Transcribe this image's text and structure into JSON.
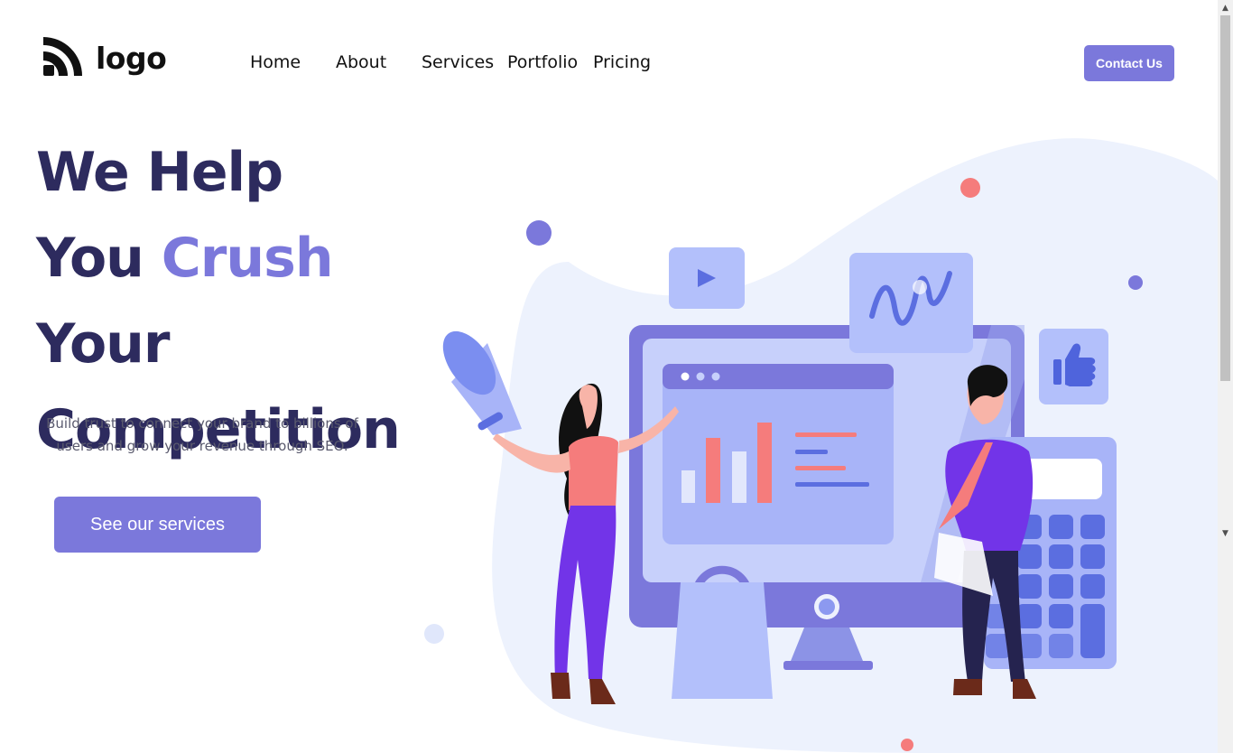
{
  "header": {
    "logo_text": "logo",
    "nav": [
      "Home",
      "About",
      "Services",
      "Portfolio",
      "Pricing"
    ],
    "contact_label": "Contact Us"
  },
  "hero": {
    "title_line1": "We Help",
    "title_line2_a": "You ",
    "title_line2_b": "Crush",
    "title_line3": "Your",
    "title_line4": "Competition",
    "subtitle": "Build trust to connect your brand to billions of users and grow your revenue through SEO.",
    "cta_label": "See our services"
  },
  "colors": {
    "accent": "#7b78db",
    "heading": "#2d2b5e",
    "coral": "#f57c7c"
  },
  "illustration": {
    "icons": [
      "play-icon",
      "wave-chart-icon",
      "thumbs-up-icon",
      "megaphone-icon",
      "calculator-icon",
      "shopping-bag-icon"
    ]
  }
}
